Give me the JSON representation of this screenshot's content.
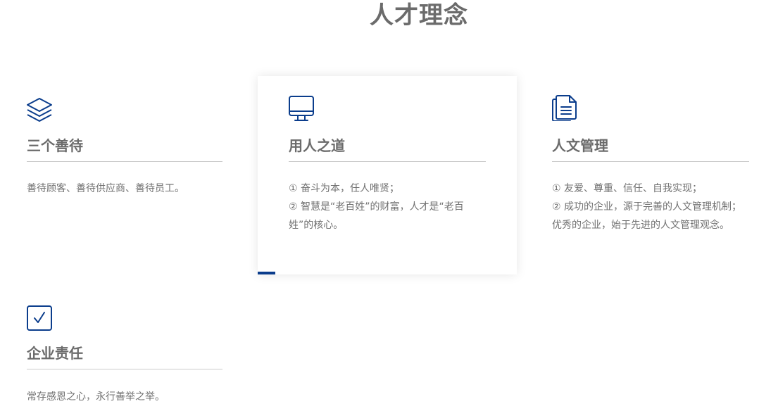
{
  "page": {
    "title": "人才理念"
  },
  "colors": {
    "accent": "#0b3d8c",
    "text": "#6b6b6b",
    "rule": "#cccccc"
  },
  "cards": [
    {
      "icon": "layers-icon",
      "title": "三个善待",
      "lines": [
        "善待顾客、善待供应商、善待员工。"
      ]
    },
    {
      "icon": "monitor-icon",
      "title": "用人之道",
      "lines": [
        "① 奋斗为本，任人唯贤；",
        "② 智慧是“老百姓”的财富，人才是“老百姓”的核心。"
      ]
    },
    {
      "icon": "documents-icon",
      "title": "人文管理",
      "lines": [
        "① 友爱、尊重、信任、自我实现；",
        "② 成功的企业，源于完善的人文管理机制；优秀的企业，始于先进的人文管理观念。"
      ]
    },
    {
      "icon": "checkbox-icon",
      "title": "企业责任",
      "lines": [
        "常存感恩之心，永行善举之举。"
      ]
    }
  ]
}
